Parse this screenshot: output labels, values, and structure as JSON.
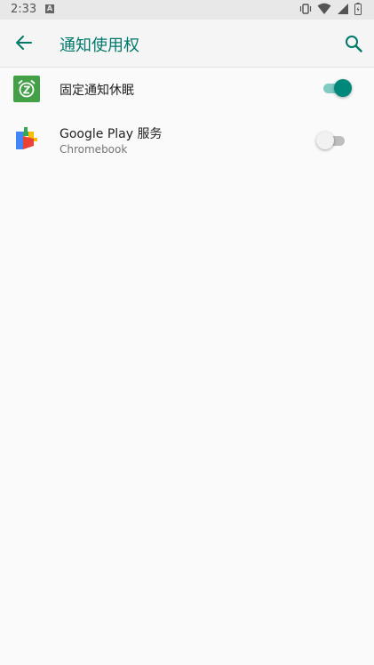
{
  "status_bar": {
    "time": "2:33",
    "notification_icon": "A",
    "icons": [
      "vibrate-icon",
      "wifi-icon",
      "signal-icon",
      "battery-icon"
    ]
  },
  "app_bar": {
    "title": "通知使用权",
    "back_icon": "arrow-back-icon",
    "search_icon": "search-icon"
  },
  "list": [
    {
      "title": "固定通知休眠",
      "subtitle": "",
      "icon": "snooze-alarm-icon",
      "enabled": true
    },
    {
      "title": "Google Play 服务",
      "subtitle": "Chromebook",
      "icon": "google-play-services-icon",
      "enabled": false
    }
  ],
  "colors": {
    "accent": "#00796b",
    "switch_on": "#00897b",
    "status_bar": "#e8e8e8"
  }
}
